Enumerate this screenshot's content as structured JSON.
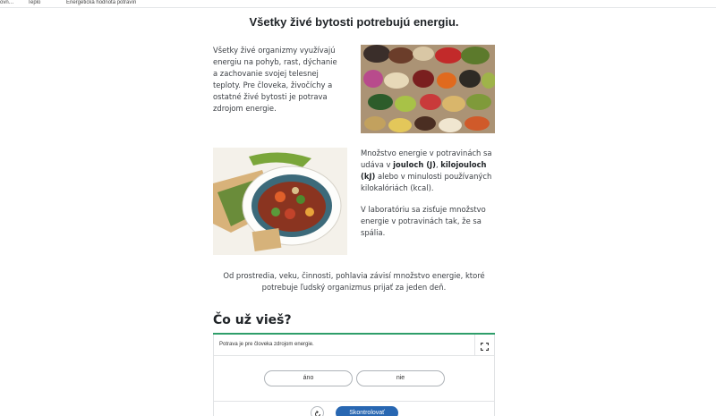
{
  "breadcrumb": {
    "item1": "ovn…",
    "item2": "Teplo",
    "item3": "Energetická hodnota potravín"
  },
  "page_title": "Všetky živé bytosti potrebujú energiu.",
  "para1": "Všetky živé organizmy využívajú energiu na pohyb, rast, dýchanie a zachovanie svojej telesnej teploty. Pre človeka, živočíchy a ostatné živé bytosti je potrava zdrojom energie.",
  "para2": {
    "t1": "Množstvo energie v potravinách sa udáva v ",
    "b1": "jouloch (J)",
    "t2": ", ",
    "b2": "kilojouloch (kJ)",
    "t3": " alebo v minulosti používaných kilokalóriách (kcal)."
  },
  "para3": "V laboratóriu sa zisťuje množstvo energie v potravinách tak, že sa spália.",
  "para4": "Od prostredia, veku, činnosti, pohlavia závisí množstvo energie, ktoré potrebuje ľudský organizmus prijať za jeden deň.",
  "images": {
    "superfoods": "superfoods-photo",
    "meal": "meal-photo"
  },
  "quiz": {
    "section_title": "Čo už vieš?",
    "question": "Potrava je pre človeka zdrojom energie.",
    "answer_yes": "áno",
    "answer_no": "nie",
    "check_label": "Skontrolovať",
    "fullscreen_icon": "fullscreen-icon",
    "reset_icon": "reset-icon"
  },
  "colors": {
    "accent_green": "#2e9e6a",
    "button_blue": "#2867b2"
  }
}
